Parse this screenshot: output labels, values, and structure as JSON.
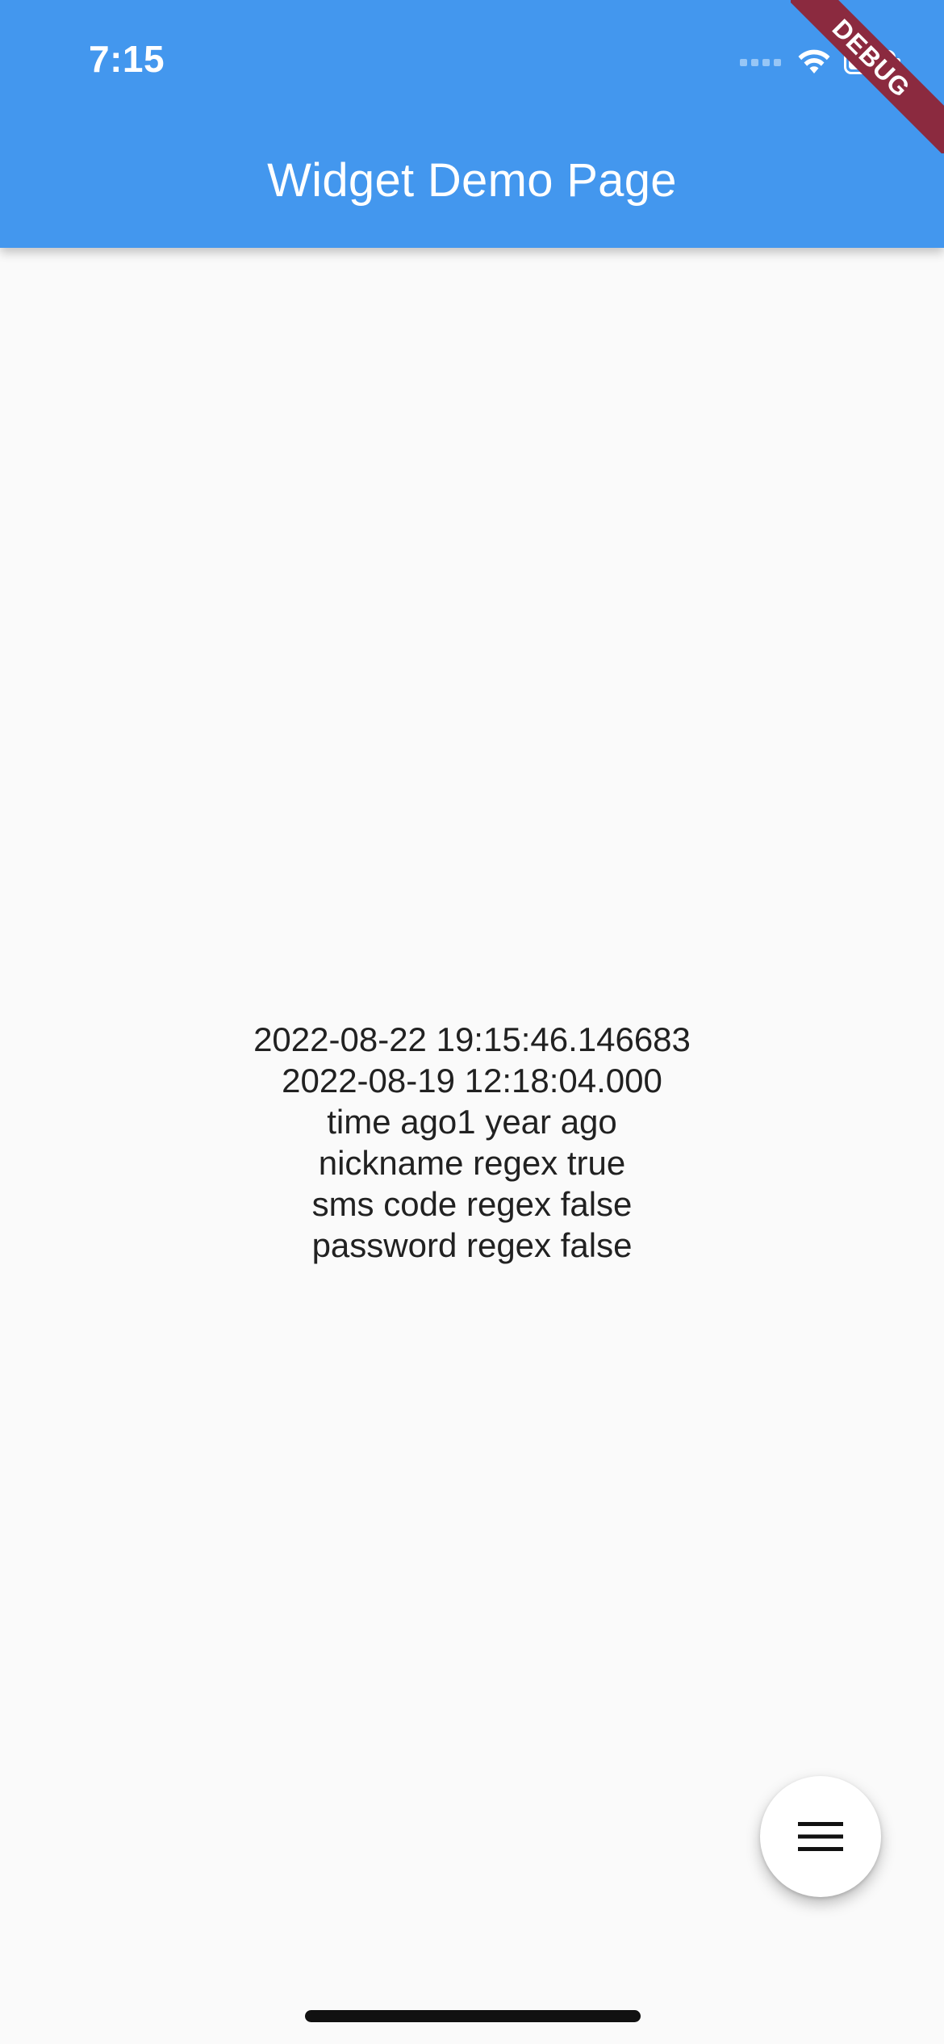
{
  "status_bar": {
    "time": "7:15",
    "icons": [
      "cellular-signal-icon",
      "wifi-icon",
      "battery-icon"
    ]
  },
  "app_bar": {
    "title": "Widget Demo Page",
    "color": "#4397ee"
  },
  "debug_banner": {
    "label": "DEBUG",
    "color": "#8b2a3f"
  },
  "content": {
    "lines": [
      "2022-08-22 19:15:46.146683",
      "2022-08-19 12:18:04.000",
      "time ago1 year ago",
      "nickname regex true",
      "sms code regex false",
      "password regex false"
    ]
  },
  "fab": {
    "icon": "menu-icon"
  }
}
